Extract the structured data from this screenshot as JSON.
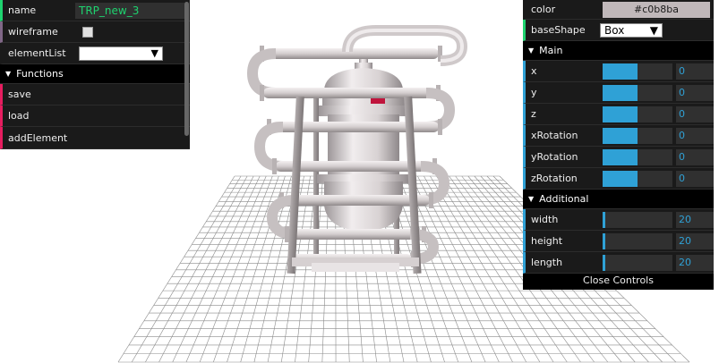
{
  "left_panel": {
    "name_label": "name",
    "name_value": "TRP_new_3",
    "wireframe_label": "wireframe",
    "element_list_label": "elementList",
    "element_list_value": "",
    "functions_title": "Functions",
    "save_label": "save",
    "load_label": "load",
    "add_element_label": "addElement"
  },
  "right_panel": {
    "color_label": "color",
    "color_value": "#c0b8ba",
    "base_shape_label": "baseShape",
    "base_shape_value": "Box",
    "main_title": "Main",
    "main_rows": [
      {
        "label": "x",
        "value": "0",
        "fill": 0.5
      },
      {
        "label": "y",
        "value": "0",
        "fill": 0.5
      },
      {
        "label": "z",
        "value": "0",
        "fill": 0.5
      },
      {
        "label": "xRotation",
        "value": "0",
        "fill": 0.5
      },
      {
        "label": "yRotation",
        "value": "0",
        "fill": 0.5
      },
      {
        "label": "zRotation",
        "value": "0",
        "fill": 0.5
      }
    ],
    "additional_title": "Additional",
    "additional_rows": [
      {
        "label": "width",
        "value": "20",
        "fill": 0.04
      },
      {
        "label": "height",
        "value": "20",
        "fill": 0.04
      },
      {
        "label": "length",
        "value": "20",
        "fill": 0.04
      }
    ],
    "close_label": "Close Controls"
  },
  "colors": {
    "panel_bg": "#1a1a1a",
    "string_accent": "#1ed36f",
    "number_accent": "#2fa1d6",
    "function_accent": "#e61d5f",
    "boolean_accent": "#806787",
    "model_color": "#c0b8ba",
    "highlight": "#c0143c"
  }
}
